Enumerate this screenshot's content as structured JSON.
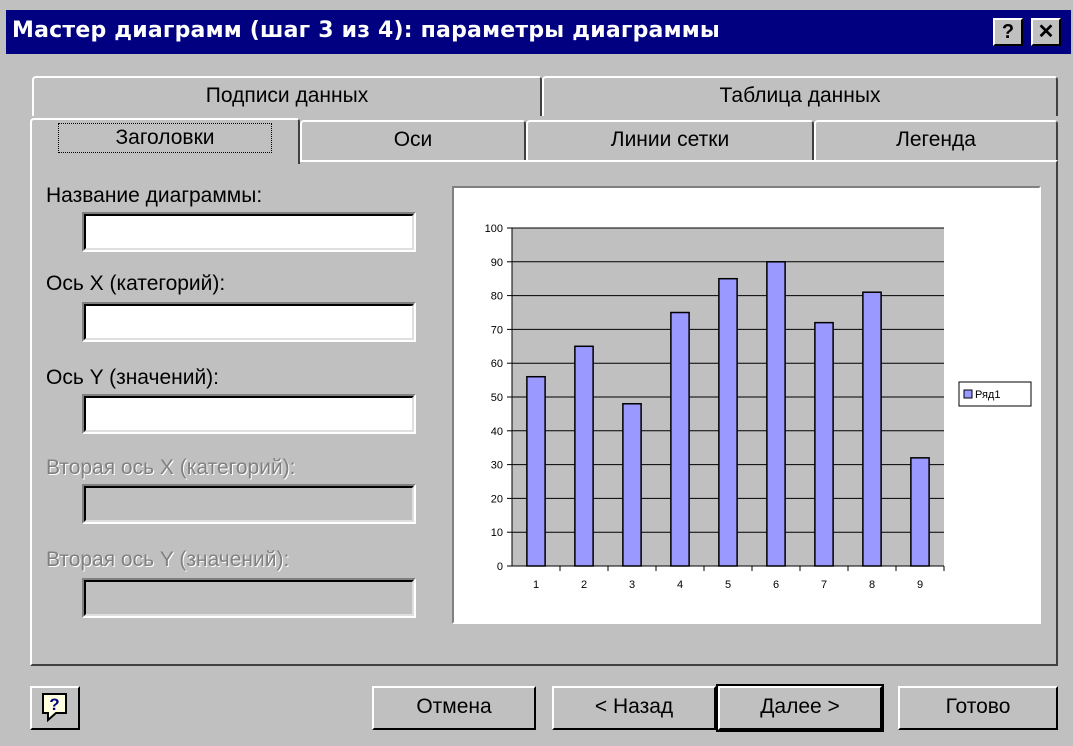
{
  "window": {
    "title": "Мастер диаграмм (шаг 3 из 4): параметры диаграммы",
    "help_button": "?",
    "close_button": "✕"
  },
  "tabs": {
    "row_back": [
      "Подписи данных",
      "Таблица данных"
    ],
    "row_front": [
      "Заголовки",
      "Оси",
      "Линии сетки",
      "Легенда"
    ],
    "active": "Заголовки"
  },
  "form": {
    "chart_title_label": "Название диаграммы:",
    "chart_title_value": "",
    "x_axis_label": "Ось X (категорий):",
    "x_axis_value": "",
    "y_axis_label": "Ось Y (значений):",
    "y_axis_value": "",
    "x2_axis_label": "Вторая ось X (категорий):",
    "x2_axis_value": "",
    "y2_axis_label": "Вторая ось Y (значений):",
    "y2_axis_value": ""
  },
  "chart_data": {
    "type": "bar",
    "categories": [
      "1",
      "2",
      "3",
      "4",
      "5",
      "6",
      "7",
      "8",
      "9"
    ],
    "series": [
      {
        "name": "Ряд1",
        "values": [
          56,
          65,
          48,
          75,
          85,
          90,
          72,
          81,
          32
        ]
      }
    ],
    "ylim": [
      0,
      100
    ],
    "yticks": [
      "0",
      "10",
      "20",
      "30",
      "40",
      "50",
      "60",
      "70",
      "80",
      "90",
      "100"
    ],
    "grid": true,
    "legend_position": "right",
    "bar_color": "#9999ff",
    "plot_background": "#c0c0c0"
  },
  "buttons": {
    "cancel": "Отмена",
    "back": "< Назад",
    "next": "Далее >",
    "finish": "Готово",
    "help_icon": "help-question-icon"
  }
}
